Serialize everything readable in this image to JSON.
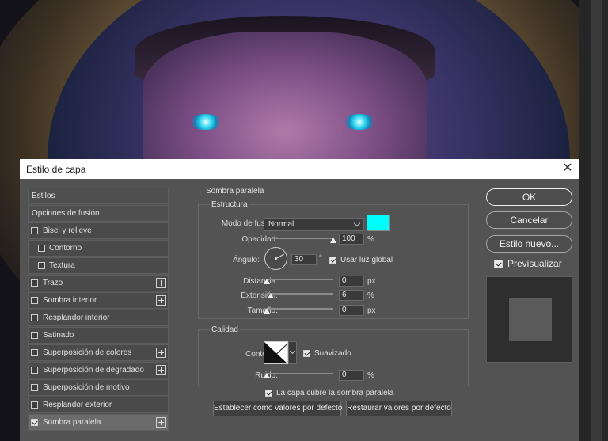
{
  "dialog": {
    "title": "Estilo de capa"
  },
  "styles_list": [
    {
      "label": "Estilos",
      "type": "head",
      "checkbox": false,
      "checked": false,
      "plus": false
    },
    {
      "label": "Opciones de fusión",
      "type": "head",
      "checkbox": false,
      "checked": false,
      "plus": false
    },
    {
      "label": "Bisel y relieve",
      "type": "item",
      "checkbox": true,
      "checked": false,
      "plus": false
    },
    {
      "label": "Contorno",
      "type": "indent",
      "checkbox": true,
      "checked": false,
      "plus": false
    },
    {
      "label": "Textura",
      "type": "indent",
      "checkbox": true,
      "checked": false,
      "plus": false
    },
    {
      "label": "Trazo",
      "type": "item",
      "checkbox": true,
      "checked": false,
      "plus": true
    },
    {
      "label": "Sombra interior",
      "type": "item",
      "checkbox": true,
      "checked": false,
      "plus": true
    },
    {
      "label": "Resplandor interior",
      "type": "item",
      "checkbox": true,
      "checked": false,
      "plus": false
    },
    {
      "label": "Satinado",
      "type": "item",
      "checkbox": true,
      "checked": false,
      "plus": false
    },
    {
      "label": "Superposición de colores",
      "type": "item",
      "checkbox": true,
      "checked": false,
      "plus": true
    },
    {
      "label": "Superposición de degradado",
      "type": "item",
      "checkbox": true,
      "checked": false,
      "plus": true
    },
    {
      "label": "Superposición de motivo",
      "type": "item",
      "checkbox": true,
      "checked": false,
      "plus": false
    },
    {
      "label": "Resplandor exterior",
      "type": "item",
      "checkbox": true,
      "checked": false,
      "plus": false
    },
    {
      "label": "Sombra paralela",
      "type": "item",
      "checkbox": true,
      "checked": true,
      "plus": true,
      "active": true
    }
  ],
  "panel": {
    "title": "Sombra paralela",
    "structure": {
      "title": "Estructura",
      "blend_mode_label": "Modo de fusión:",
      "blend_mode_value": "Normal",
      "shadow_color": "#00fdfd",
      "opacity_label": "Opacidad:",
      "opacity_value": "100",
      "opacity_unit": "%",
      "opacity_level": 1.0,
      "angle_label": "Ángulo:",
      "angle_value": "30",
      "angle_unit": "°",
      "global_light_label": "Usar luz global",
      "global_light_checked": true,
      "distance_label": "Distancia:",
      "distance_value": "0",
      "distance_unit": "px",
      "distance_level": 0,
      "spread_label": "Extensión:",
      "spread_value": "6",
      "spread_unit": "%",
      "spread_level": 0.06,
      "size_label": "Tamaño:",
      "size_value": "0",
      "size_unit": "px",
      "size_level": 0
    },
    "quality": {
      "title": "Calidad",
      "contour_label": "Contorno:",
      "antialias_label": "Suavizado",
      "antialias_checked": true,
      "noise_label": "Ruido:",
      "noise_value": "0",
      "noise_unit": "%",
      "noise_level": 0
    },
    "knockout_label": "La capa cubre la sombra paralela",
    "knockout_checked": true,
    "make_default_label": "Establecer como valores por defecto",
    "reset_default_label": "Restaurar valores por defecto"
  },
  "actions": {
    "ok_label": "OK",
    "cancel_label": "Cancelar",
    "new_style_label": "Estilo nuevo...",
    "preview_label": "Previsualizar",
    "preview_checked": true
  }
}
